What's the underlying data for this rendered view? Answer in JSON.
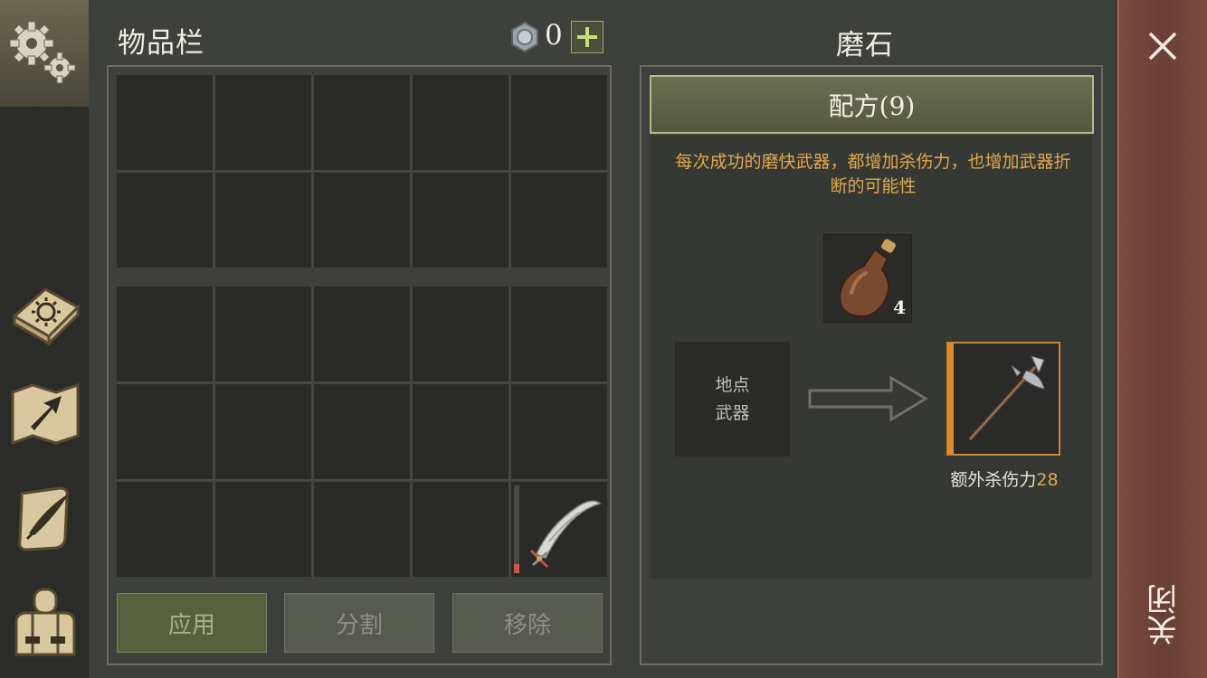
{
  "sidebar": {
    "items": [
      {
        "icon": "settings-gears-icon"
      },
      {
        "icon": "sun-book-icon"
      },
      {
        "icon": "map-arrow-icon"
      },
      {
        "icon": "quill-scroll-icon"
      },
      {
        "icon": "backpack-icon"
      }
    ]
  },
  "inventory": {
    "title": "物品栏",
    "currency_value": "0",
    "add_label": "+",
    "item_weapon_icon": "scimitar-icon"
  },
  "actions": {
    "apply": "应用",
    "split": "分割",
    "remove": "移除"
  },
  "recipe": {
    "title": "磨石",
    "tab_label": "配方(9)",
    "description": "每次成功的磨快武器，都增加杀伤力，也增加武器折断的可能性",
    "ingredient_icon": "bottle-icon",
    "ingredient_count": "4",
    "location_line1": "地点",
    "location_line2": "武器",
    "result_icon": "halberd-icon",
    "bonus_label": "额外杀伤力",
    "bonus_value": "28"
  },
  "close_panel": {
    "label": "关闭"
  },
  "colors": {
    "accent_orange": "#e0a84e",
    "result_border": "#c98635",
    "close_panel": "#6b3f36"
  }
}
